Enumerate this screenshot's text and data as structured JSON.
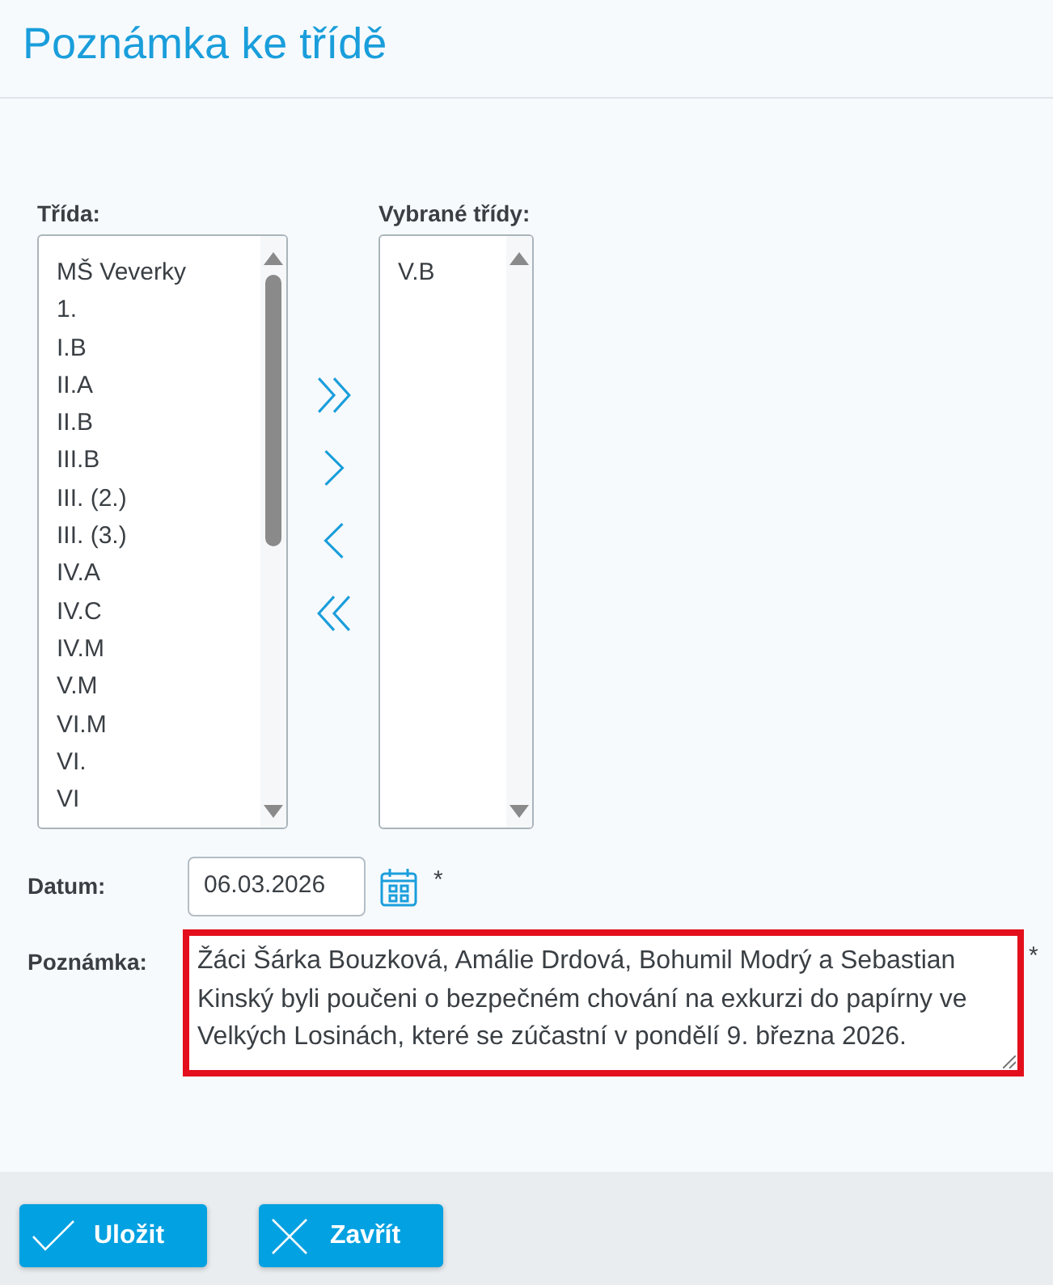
{
  "header": {
    "title": "Poznámka ke třídě"
  },
  "class_picker": {
    "available": {
      "label": "Třída:",
      "items": [
        {
          "text": "MŠ Veverky",
          "selected": false
        },
        {
          "text": "1.",
          "selected": false
        },
        {
          "text": "I.B",
          "selected": false
        },
        {
          "text": "II.A",
          "selected": false
        },
        {
          "text": "II.B",
          "selected": false
        },
        {
          "text": "III.B",
          "selected": false
        },
        {
          "text": "III. (2.)",
          "selected": false
        },
        {
          "text": "III. (3.)",
          "selected": false
        },
        {
          "text": "IV.A",
          "selected": false
        },
        {
          "text": "IV.C",
          "selected": false
        },
        {
          "text": "IV.M",
          "selected": false
        },
        {
          "text": "V.M",
          "selected": false
        },
        {
          "text": "VI.M",
          "selected": false
        },
        {
          "text": "VI.",
          "selected": false
        },
        {
          "text": "VI",
          "selected": false
        }
      ]
    },
    "transfer_buttons": [
      {
        "kind": "add_all"
      },
      {
        "kind": "add"
      },
      {
        "kind": "remove"
      },
      {
        "kind": "remove_all"
      }
    ],
    "chosen": {
      "label": "Vybrané třídy:",
      "items": [
        {
          "text": "V.B",
          "selected": false
        }
      ]
    }
  },
  "date": {
    "label": "Datum:",
    "value": "06.03.2026",
    "required_mark": "*"
  },
  "note": {
    "label": "Poznámka:",
    "value": "Žáci Šárka Bouzková, Amálie Drdová, Bohumil Modrý a Sebastian Kinský byli poučeni o bezpečném chování na exkurzi do papírny ve Velkých Losinách, které se zúčastní v pondělí 9. března 2026.",
    "highlighted": true,
    "required_mark": "*"
  },
  "footer": {
    "buttons": [
      {
        "kind": "save",
        "label": "Uložit"
      },
      {
        "kind": "close",
        "label": "Zavřít"
      }
    ]
  }
}
